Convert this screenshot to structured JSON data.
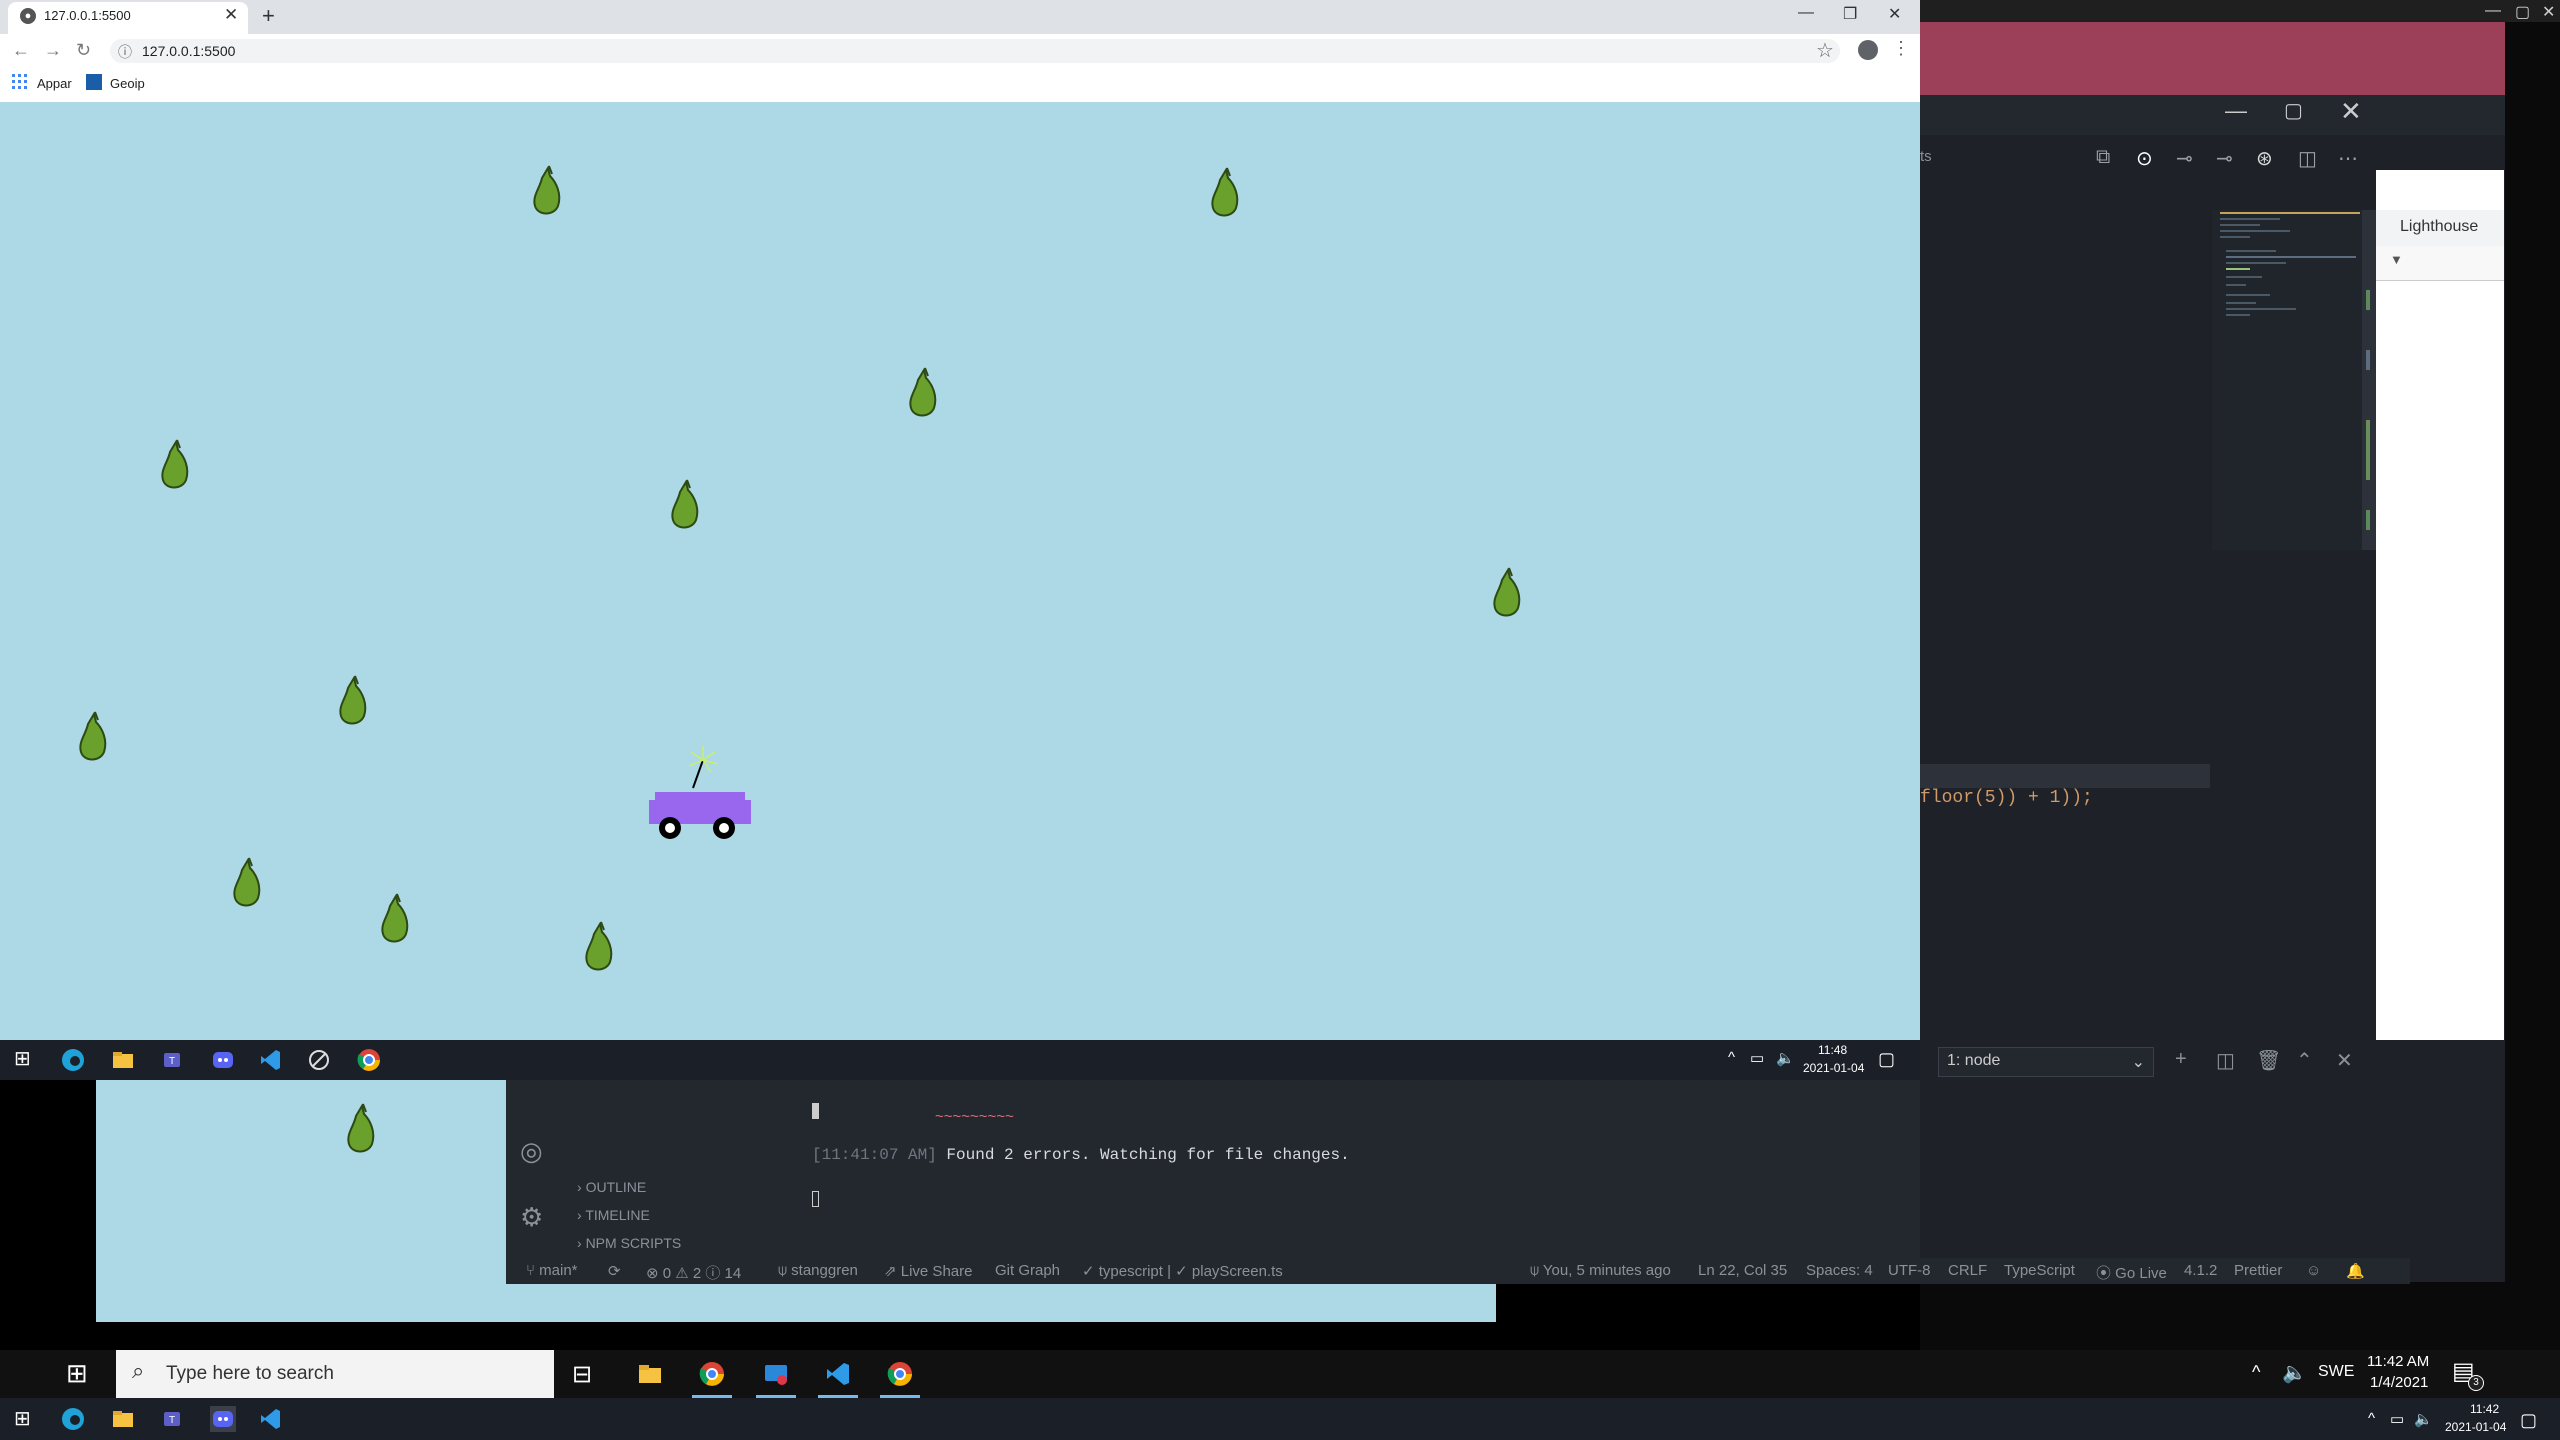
{
  "browser": {
    "tab_title": "127.0.0.1:5500",
    "url": "127.0.0.1:5500",
    "bookmarks": [
      {
        "label": "Appar",
        "icon": "apps-grid-icon"
      },
      {
        "label": "Geoip",
        "icon": "geoip-icon"
      }
    ],
    "window_controls": [
      "minimize",
      "restore",
      "close"
    ]
  },
  "game": {
    "background": "#add8e6",
    "pear_color": "#6aa12c",
    "car_color": "#9966ee",
    "pear_count": 13
  },
  "inner_taskbar": {
    "time": "11:48",
    "date": "2021-01-04"
  },
  "vscode": {
    "code_line": "floor(5)) + 1));",
    "terminal_select": "1: node",
    "devtools_tab": "Lighthouse",
    "terminal_output": {
      "squiggle": "~~~~~~~~~",
      "time": "[11:41:07 AM]",
      "message": " Found 2 errors. Watching for file changes."
    },
    "sidebar_sections": [
      "OUTLINE",
      "TIMELINE",
      "NPM SCRIPTS"
    ],
    "statusbar": {
      "branch": "main*",
      "problems": "0 ⚠ 2 ⓘ 14",
      "user": "stanggren",
      "live_share": "Live Share",
      "git_graph": "Git Graph",
      "ts_status": "✓ typescript | ✓ playScreen.ts",
      "blame": "You, 5 minutes ago",
      "position": "Ln 22, Col 35",
      "spaces": "Spaces: 4",
      "encoding": "UTF-8",
      "eol": "CRLF",
      "language": "TypeScript",
      "go_live": "Go Live",
      "ts_version": "4.1.2",
      "prettier": "Prettier"
    }
  },
  "host_taskbar": {
    "search_placeholder": "Type here to search",
    "language": "SWE",
    "time": "11:42 AM",
    "date": "1/4/2021",
    "notification_count": "3"
  },
  "bottom_taskbar": {
    "time": "11:42",
    "date": "2021-01-04"
  }
}
